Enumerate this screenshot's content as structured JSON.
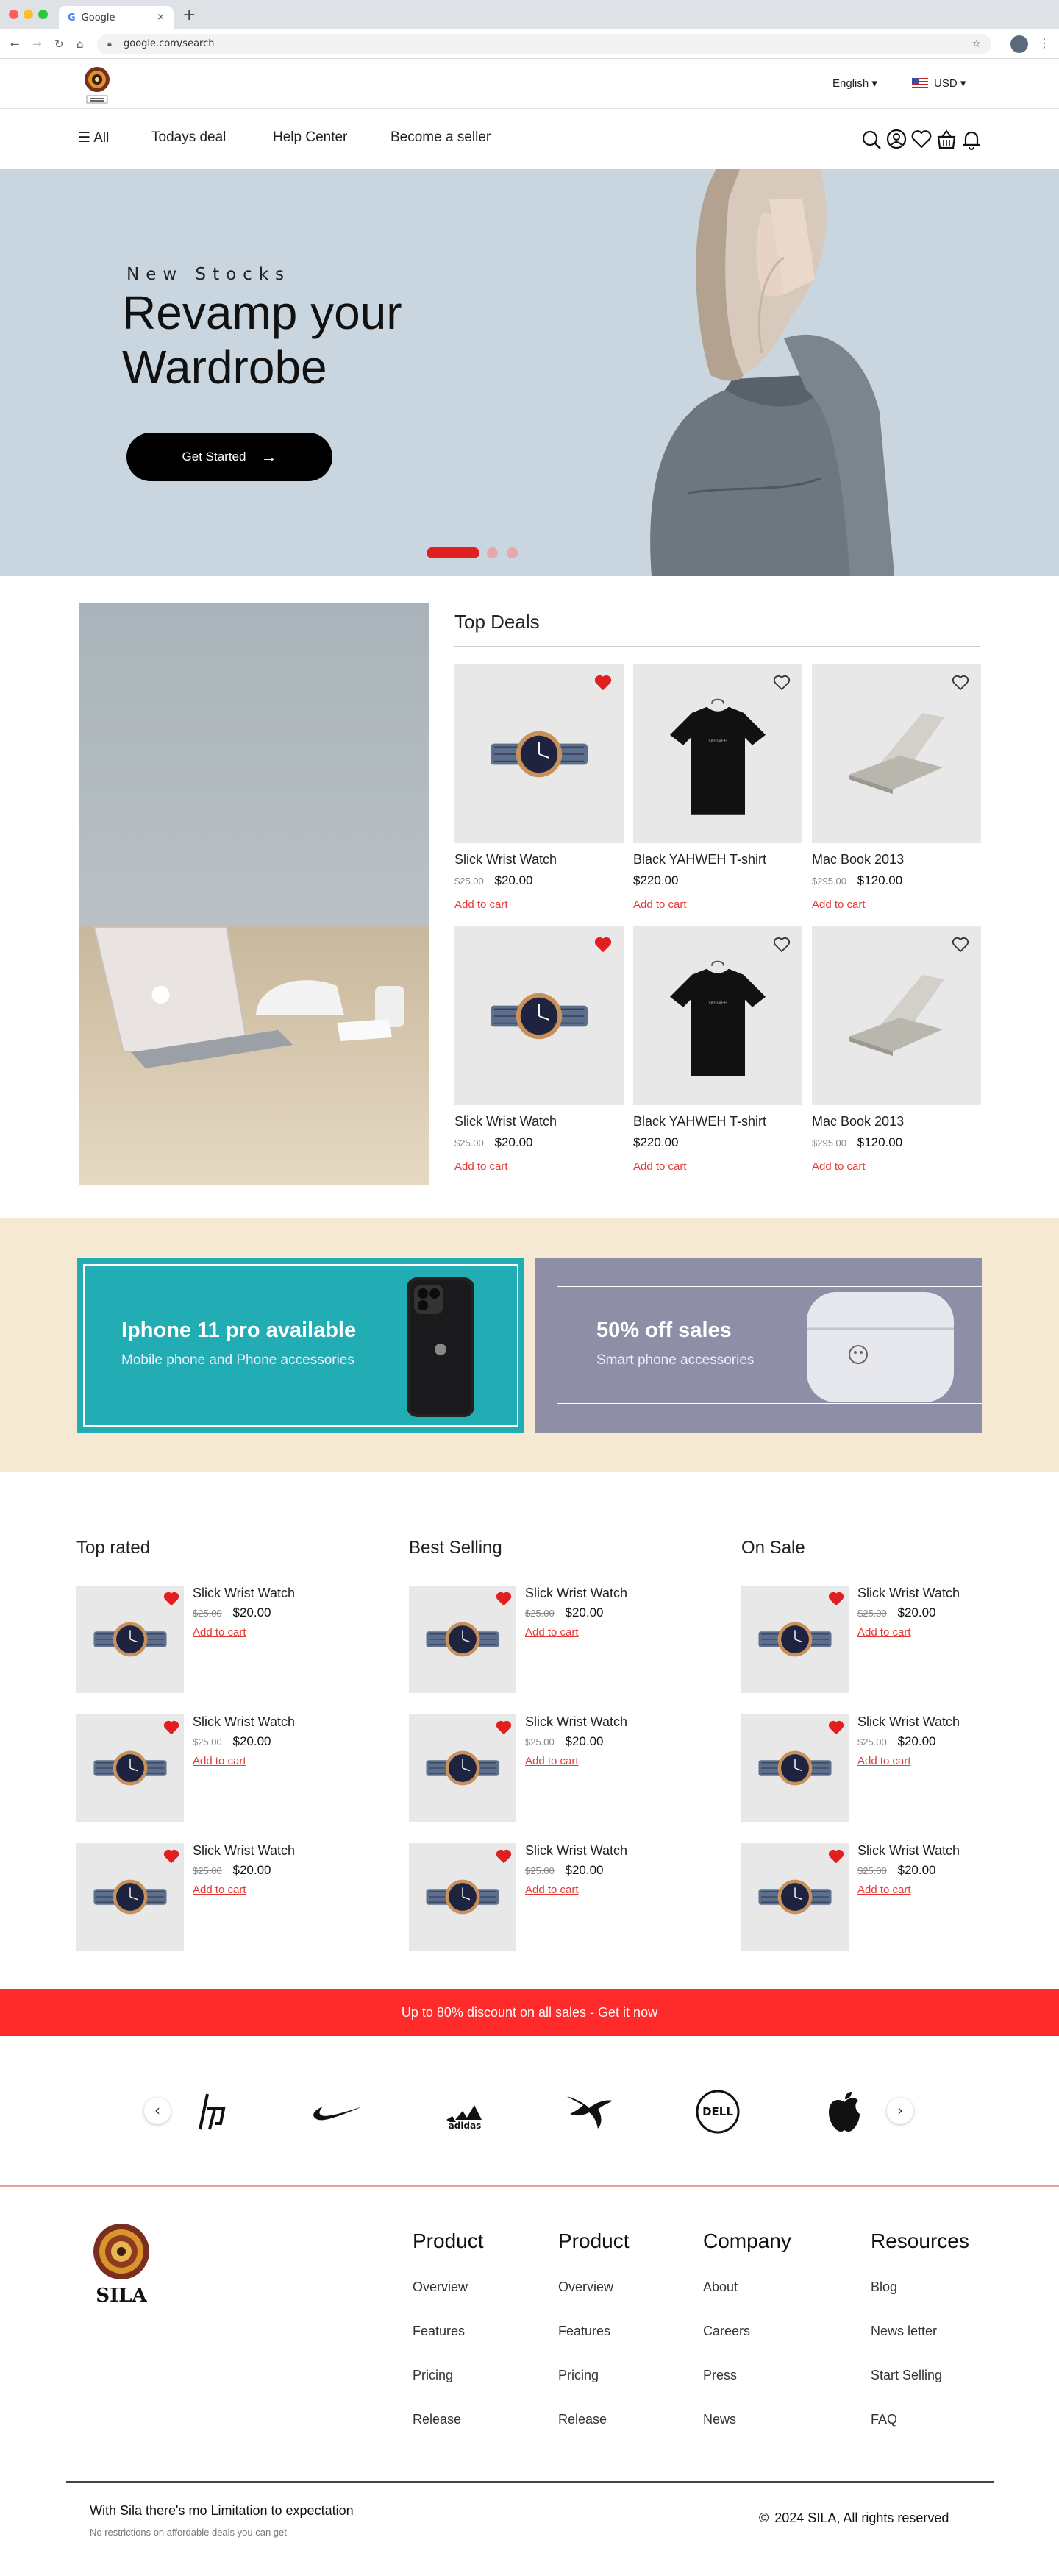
{
  "browser": {
    "tab_title": "Google",
    "tab_close": "×",
    "new_tab": "+",
    "url": "google.com/search"
  },
  "header": {
    "language": "English ▾",
    "currency": "USD ▾"
  },
  "nav": {
    "all": "☰ All",
    "items": [
      "Todays deal",
      "Help Center",
      "Become a seller"
    ]
  },
  "hero": {
    "eyebrow": "New Stocks",
    "title": "Revamp your Wardrobe",
    "cta": "Get Started",
    "cta_arrow": "→",
    "active_slide": 1,
    "slide_count": 3
  },
  "top_deals": {
    "title": "Top Deals",
    "add_label": "Add to cart",
    "products": [
      {
        "name": "Slick Wrist Watch",
        "old": "$25.00",
        "price": "$20.00",
        "favorite": true,
        "kind": "watch"
      },
      {
        "name": "Black YAHWEH T-shirt",
        "old": "",
        "price": "$220.00",
        "favorite": false,
        "kind": "shirt"
      },
      {
        "name": "Mac Book 2013",
        "old": "$295.00",
        "price": "$120.00",
        "favorite": false,
        "kind": "laptop"
      },
      {
        "name": "Slick Wrist Watch",
        "old": "$25.00",
        "price": "$20.00",
        "favorite": true,
        "kind": "watch"
      },
      {
        "name": "Black YAHWEH T-shirt",
        "old": "",
        "price": "$220.00",
        "favorite": false,
        "kind": "shirt"
      },
      {
        "name": "Mac Book 2013",
        "old": "$295.00",
        "price": "$120.00",
        "favorite": false,
        "kind": "laptop"
      }
    ]
  },
  "promos": [
    {
      "title": "Iphone 11 pro available",
      "subtitle": "Mobile phone and Phone accessories",
      "color": "#22adb4"
    },
    {
      "title": "50% off sales",
      "subtitle": "Smart phone accessories",
      "color": "#8e8fa6"
    }
  ],
  "lists": {
    "add_label": "Add to cart",
    "columns": [
      {
        "title": "Top rated",
        "items": [
          {
            "name": "Slick Wrist Watch",
            "old": "$25.00",
            "price": "$20.00"
          },
          {
            "name": "Slick Wrist Watch",
            "old": "$25.00",
            "price": "$20.00"
          },
          {
            "name": "Slick Wrist Watch",
            "old": "$25.00",
            "price": "$20.00"
          }
        ]
      },
      {
        "title": "Best Selling",
        "items": [
          {
            "name": "Slick Wrist Watch",
            "old": "$25.00",
            "price": "$20.00"
          },
          {
            "name": "Slick Wrist Watch",
            "old": "$25.00",
            "price": "$20.00"
          },
          {
            "name": "Slick Wrist Watch",
            "old": "$25.00",
            "price": "$20.00"
          }
        ]
      },
      {
        "title": "On Sale",
        "items": [
          {
            "name": "Slick Wrist Watch",
            "old": "$25.00",
            "price": "$20.00"
          },
          {
            "name": "Slick Wrist Watch",
            "old": "$25.00",
            "price": "$20.00"
          },
          {
            "name": "Slick Wrist Watch",
            "old": "$25.00",
            "price": "$20.00"
          }
        ]
      }
    ]
  },
  "sale_banner": {
    "text": "Up to 80% discount on all sales - ",
    "link": "Get it now",
    "color": "#ff2a2a"
  },
  "brands": {
    "prev": "‹",
    "next": "›",
    "items": [
      "hp-logo",
      "nike-logo",
      "adidas-logo",
      "puma-logo",
      "dell-logo",
      "apple-logo"
    ]
  },
  "footer": {
    "columns": [
      {
        "title": "Product",
        "links": [
          "Overview",
          "Features",
          "Pricing",
          "Release"
        ]
      },
      {
        "title": "Product",
        "links": [
          "Overview",
          "Features",
          "Pricing",
          "Release"
        ]
      },
      {
        "title": "Company",
        "links": [
          "About",
          "Careers",
          "Press",
          "News"
        ]
      },
      {
        "title": "Resources",
        "links": [
          "Blog",
          "News letter",
          "Start Selling",
          "FAQ"
        ]
      }
    ],
    "tagline": "With Sila there's mo Limitation to expectation",
    "subline": "No restrictions on affordable deals you can get",
    "copyright": "2024 SILA, All rights reserved",
    "copyright_icon": "©"
  },
  "colors": {
    "accent": "#e53935",
    "hero_bg": "#c9d6df",
    "promo_band": "#f5e9d4"
  }
}
